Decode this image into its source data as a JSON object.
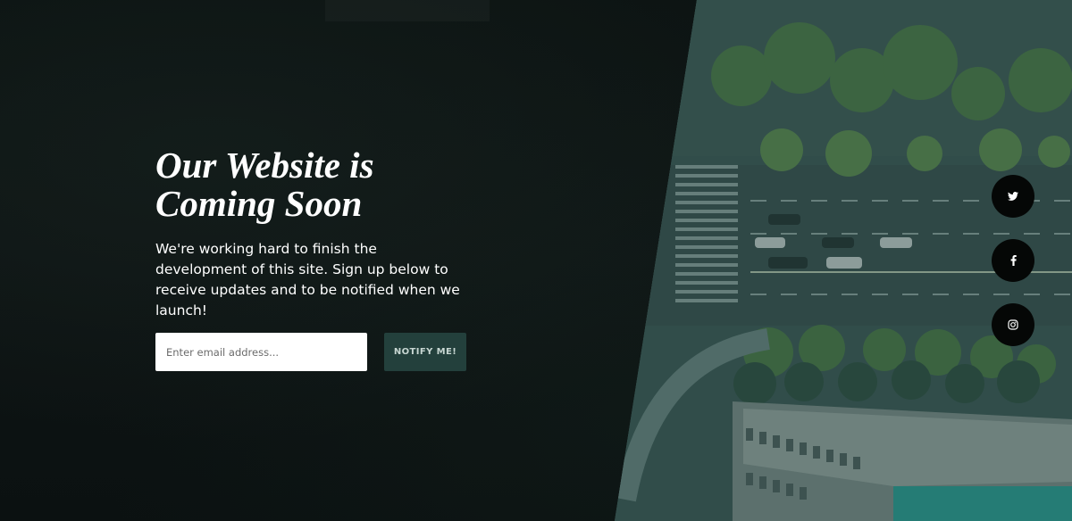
{
  "hero": {
    "title": "Our Website is Coming Soon",
    "description": "We're working hard to finish the development of this site. Sign up below to receive updates and to be notified when we launch!"
  },
  "form": {
    "email_placeholder": "Enter email address...",
    "email_value": "",
    "submit_label": "NOTIFY ME!"
  },
  "social": [
    {
      "name": "twitter",
      "icon": "twitter-icon"
    },
    {
      "name": "facebook",
      "icon": "facebook-icon"
    },
    {
      "name": "instagram",
      "icon": "instagram-icon"
    }
  ],
  "colors": {
    "background": "#0d1212",
    "button": "#23403c",
    "button_text": "#c7d6d2",
    "social_bg": "#050706",
    "photo_tint": "#3a5652"
  }
}
